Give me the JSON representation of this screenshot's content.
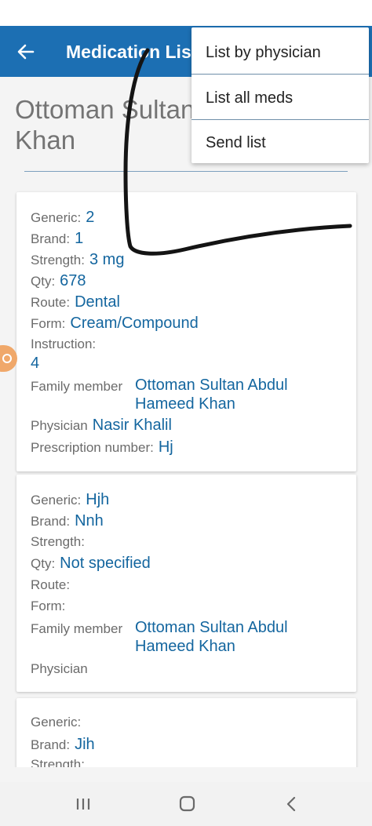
{
  "app_bar": {
    "title": "Medication List",
    "back_icon": "arrow-left-icon"
  },
  "patient": {
    "name": "Ottoman Sultan Khan"
  },
  "menu": {
    "items": [
      {
        "label": "List by physician"
      },
      {
        "label": "List all meds"
      },
      {
        "label": "Send list"
      }
    ]
  },
  "meds": [
    {
      "generic_label": "Generic:",
      "generic": "2",
      "brand_label": "Brand:",
      "brand": "1",
      "strength_label": "Strength:",
      "strength": "3 mg",
      "qty_label": "Qty:",
      "qty": "678",
      "route_label": "Route:",
      "route": "Dental",
      "form_label": "Form:",
      "form": "Cream/Compound",
      "instruction_label": "Instruction:",
      "instruction": "4",
      "family_label": "Family member",
      "family_line1": "Ottoman Sultan Abdul",
      "family_line2": "Hameed Khan",
      "physician_label": "Physician",
      "physician": "Nasir Khalil",
      "rx_label": "Prescription number:",
      "rx": "Hj"
    },
    {
      "generic_label": "Generic:",
      "generic": "Hjh",
      "brand_label": "Brand:",
      "brand": "Nnh",
      "strength_label": "Strength:",
      "qty_label": "Qty:",
      "qty": "Not specified",
      "route_label": "Route:",
      "form_label": "Form:",
      "family_label": "Family member",
      "family_line1": "Ottoman Sultan Abdul",
      "family_line2": "Hameed Khan",
      "physician_label": "Physician"
    },
    {
      "generic_label": "Generic:",
      "brand_label": "Brand:",
      "brand": "Jih",
      "strength_label": "Strength:"
    }
  ],
  "colors": {
    "app_bar": "#1c6fb3",
    "value_text": "#14669f",
    "label_text": "#6b6b6b",
    "patient_name": "#747474"
  },
  "icons": {
    "side_bubble": "camera-bubble-icon",
    "nav_recents": "recents-icon",
    "nav_home": "home-icon",
    "nav_back": "nav-back-icon"
  }
}
